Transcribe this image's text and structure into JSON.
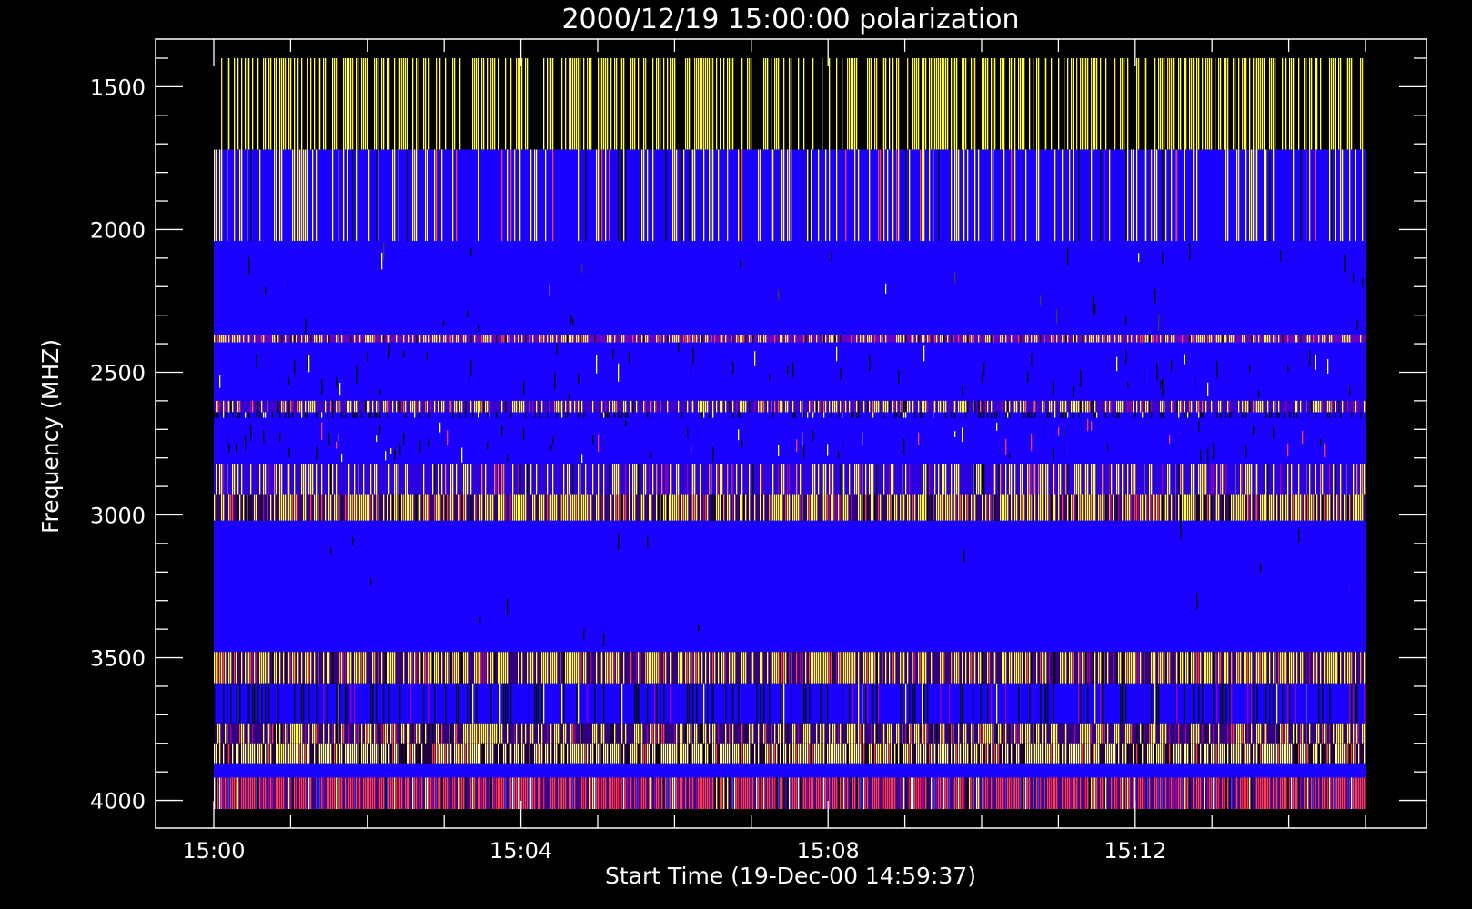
{
  "chart_data": {
    "type": "heatmap",
    "title": "2000/12/19 15:00:00 polarization",
    "xlabel": "Start Time (19-Dec-00 14:59:37)",
    "ylabel": "Frequency (MHZ)",
    "x_range": [
      "15:00:00",
      "15:15:00"
    ],
    "y_range_mhz": [
      1400,
      4030
    ],
    "y_axis_inverted": true,
    "x_ticks": [
      {
        "label": "15:00",
        "value": "15:00"
      },
      {
        "label": "15:04",
        "value": "15:04"
      },
      {
        "label": "15:08",
        "value": "15:08"
      },
      {
        "label": "15:12",
        "value": "15:12"
      }
    ],
    "x_minor_tick_minutes": 1,
    "y_ticks": [
      1500,
      2000,
      2500,
      3000,
      3500,
      4000
    ],
    "y_minor_tick_step": 100,
    "bands": [
      {
        "f_start": 1400,
        "f_end": 1720,
        "base": "#000000",
        "dominant": "#ffff40",
        "density": 0.62,
        "mix": [
          "#ffff40",
          "#ffff80",
          "#ffe040",
          "#000000"
        ]
      },
      {
        "f_start": 1720,
        "f_end": 2040,
        "base": "#1a00ff",
        "dominant": "#ffff40",
        "density": 0.3,
        "mix": [
          "#ffff40",
          "#000000",
          "#ff4040",
          "#ffe060"
        ]
      },
      {
        "f_start": 2040,
        "f_end": 2370,
        "base": "#1a00ff",
        "dominant": "#000000",
        "density": 0.06,
        "mix": [
          "#000000",
          "#ffff40",
          "#404040"
        ]
      },
      {
        "f_start": 2370,
        "f_end": 2395,
        "base": "#6a00c8",
        "dominant": "#ffff40",
        "density": 0.55,
        "mix": [
          "#ffff40",
          "#000000",
          "#ff4040"
        ]
      },
      {
        "f_start": 2395,
        "f_end": 2600,
        "base": "#1a00ff",
        "dominant": "#000000",
        "density": 0.08,
        "mix": [
          "#000000",
          "#ffff40"
        ]
      },
      {
        "f_start": 2600,
        "f_end": 2640,
        "base": "#3a00d0",
        "dominant": "#ffff40",
        "density": 0.55,
        "mix": [
          "#ffff40",
          "#000000",
          "#ff6040",
          "#a000a0"
        ]
      },
      {
        "f_start": 2640,
        "f_end": 2660,
        "base": "#1a00ff",
        "dominant": "#000000",
        "density": 0.25,
        "mix": [
          "#000000",
          "#ffff40"
        ]
      },
      {
        "f_start": 2660,
        "f_end": 2820,
        "base": "#1a00ff",
        "dominant": "#000000",
        "density": 0.15,
        "mix": [
          "#000000",
          "#ffff40",
          "#ff4040"
        ]
      },
      {
        "f_start": 2820,
        "f_end": 2930,
        "base": "#2a00e0",
        "dominant": "#ffff40",
        "density": 0.45,
        "mix": [
          "#ffff40",
          "#000000",
          "#ff8040",
          "#a000a0"
        ]
      },
      {
        "f_start": 2930,
        "f_end": 3020,
        "base": "#300080",
        "dominant": "#ffff40",
        "density": 0.75,
        "mix": [
          "#ffff40",
          "#000000",
          "#ff4040",
          "#ffa040",
          "#a000a0"
        ]
      },
      {
        "f_start": 3020,
        "f_end": 3480,
        "base": "#1a00ff",
        "dominant": "#000000",
        "density": 0.02,
        "mix": [
          "#000000"
        ]
      },
      {
        "f_start": 3480,
        "f_end": 3590,
        "base": "#300080",
        "dominant": "#ffff40",
        "density": 0.7,
        "mix": [
          "#ffff40",
          "#000000",
          "#ff4040",
          "#ffa040",
          "#a000a0"
        ]
      },
      {
        "f_start": 3590,
        "f_end": 3730,
        "base": "#1a00ff",
        "dominant": "#000000",
        "density": 0.3,
        "mix": [
          "#000000",
          "#ffff40",
          "#a000a0"
        ]
      },
      {
        "f_start": 3730,
        "f_end": 3800,
        "base": "#300080",
        "dominant": "#ffff40",
        "density": 0.6,
        "mix": [
          "#ffff40",
          "#000000",
          "#ff4040",
          "#a000a0"
        ]
      },
      {
        "f_start": 3800,
        "f_end": 3870,
        "base": "#200040",
        "dominant": "#ffffa0",
        "density": 0.8,
        "mix": [
          "#ffffa0",
          "#ffff40",
          "#000000",
          "#ff4040"
        ]
      },
      {
        "f_start": 3870,
        "f_end": 3920,
        "base": "#1a00ff",
        "dominant": "#1a00ff",
        "density": 0.0,
        "mix": []
      },
      {
        "f_start": 3920,
        "f_end": 4030,
        "base": "#3a0090",
        "dominant": "#ff4040",
        "density": 0.85,
        "mix": [
          "#ff2020",
          "#ffff40",
          "#000000",
          "#ffffff",
          "#a000a0",
          "#2a40ff"
        ]
      }
    ]
  },
  "colors": {
    "background": "#000000",
    "axes": "#ffffff",
    "blue": "#1a00ff",
    "yellow": "#ffff40"
  }
}
